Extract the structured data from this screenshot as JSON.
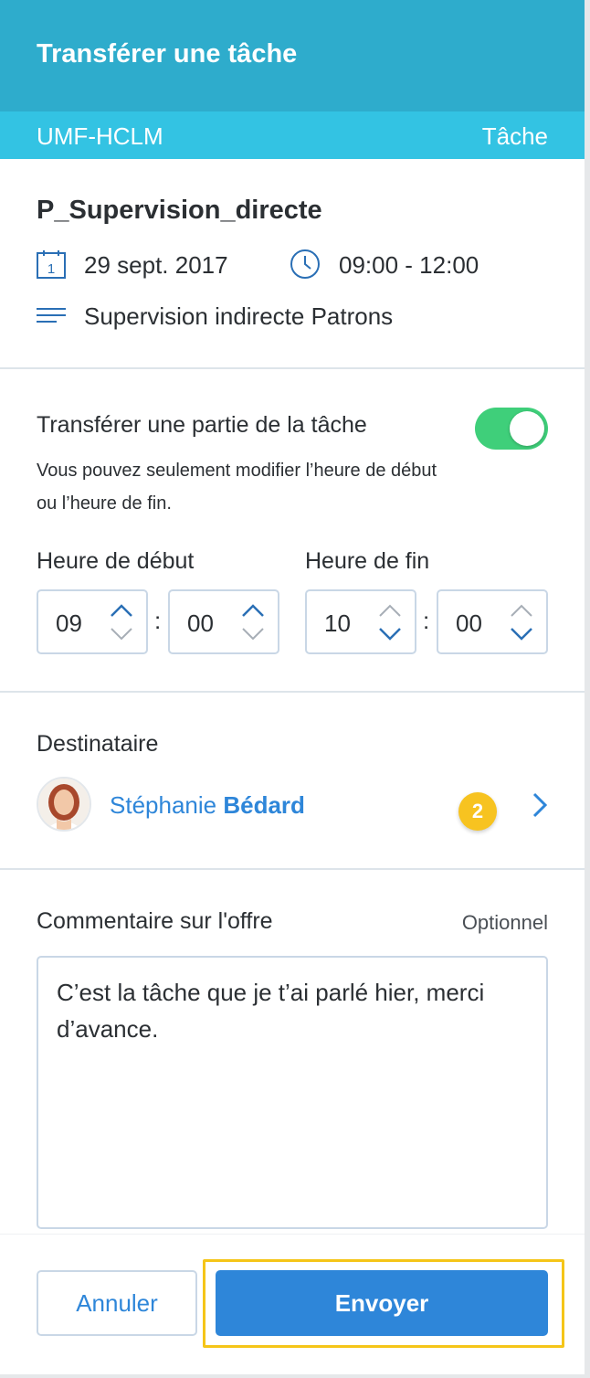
{
  "header": {
    "title": "Transférer une tâche"
  },
  "subheader": {
    "left": "UMF-HCLM",
    "right": "Tâche"
  },
  "task": {
    "name": "P_Supervision_directe",
    "date": "29 sept. 2017",
    "calendar_day": "1",
    "time": "09:00 - 12:00",
    "description": "Supervision indirecte Patrons"
  },
  "partial": {
    "label": "Transférer une partie de la tâche",
    "toggle_on": true,
    "help": "Vous pouvez seulement modifier l’heure de début ou l’heure de fin."
  },
  "time_fields": {
    "start_label": "Heure de début",
    "end_label": "Heure de fin",
    "start_hour": "09",
    "start_minute": "00",
    "end_hour": "10",
    "end_minute": "00",
    "separator": ":"
  },
  "recipient": {
    "label": "Destinataire",
    "first_name": "Stéphanie",
    "last_name": "Bédard",
    "badge_count": "2"
  },
  "comment": {
    "label": "Commentaire sur l'offre",
    "optional": "Optionnel",
    "value": "C’est la tâche que je t’ai parlé hier, merci d’avance."
  },
  "actions": {
    "cancel": "Annuler",
    "send": "Envoyer"
  },
  "colors": {
    "header": "#2eaccc",
    "subheader": "#33c3e3",
    "accent": "#2e86d9",
    "toggle": "#3fcf7a",
    "badge": "#f7c320",
    "highlight": "#f5c518"
  }
}
